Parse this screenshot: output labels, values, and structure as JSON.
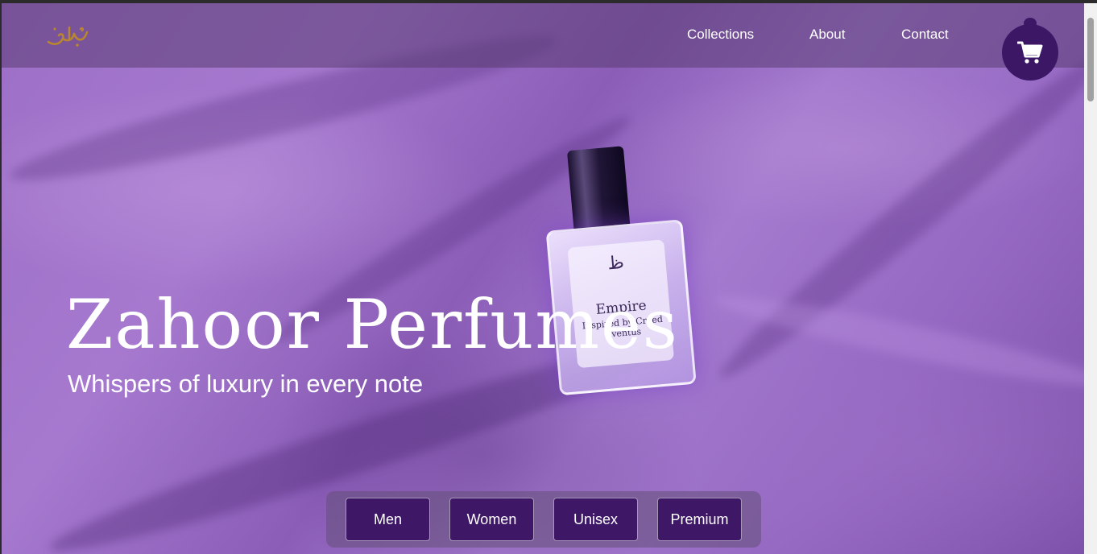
{
  "header": {
    "logo_icon": "arabic-calligraphy-logo",
    "nav": [
      {
        "label": "Collections"
      },
      {
        "label": "About"
      },
      {
        "label": "Contact"
      }
    ],
    "cart_icon": "shopping-cart-icon"
  },
  "hero": {
    "title": "Zahoor Perfumes",
    "subtitle": "Whispers of luxury in every note",
    "product": {
      "brand": "Empire",
      "line": "Inspired by Creed Aventus"
    }
  },
  "filters": [
    {
      "label": "Men"
    },
    {
      "label": "Women"
    },
    {
      "label": "Unisex"
    },
    {
      "label": "Premium"
    }
  ],
  "colors": {
    "accent": "#3e1867",
    "text": "#ffffff",
    "logo_gold": "#b8862e"
  }
}
